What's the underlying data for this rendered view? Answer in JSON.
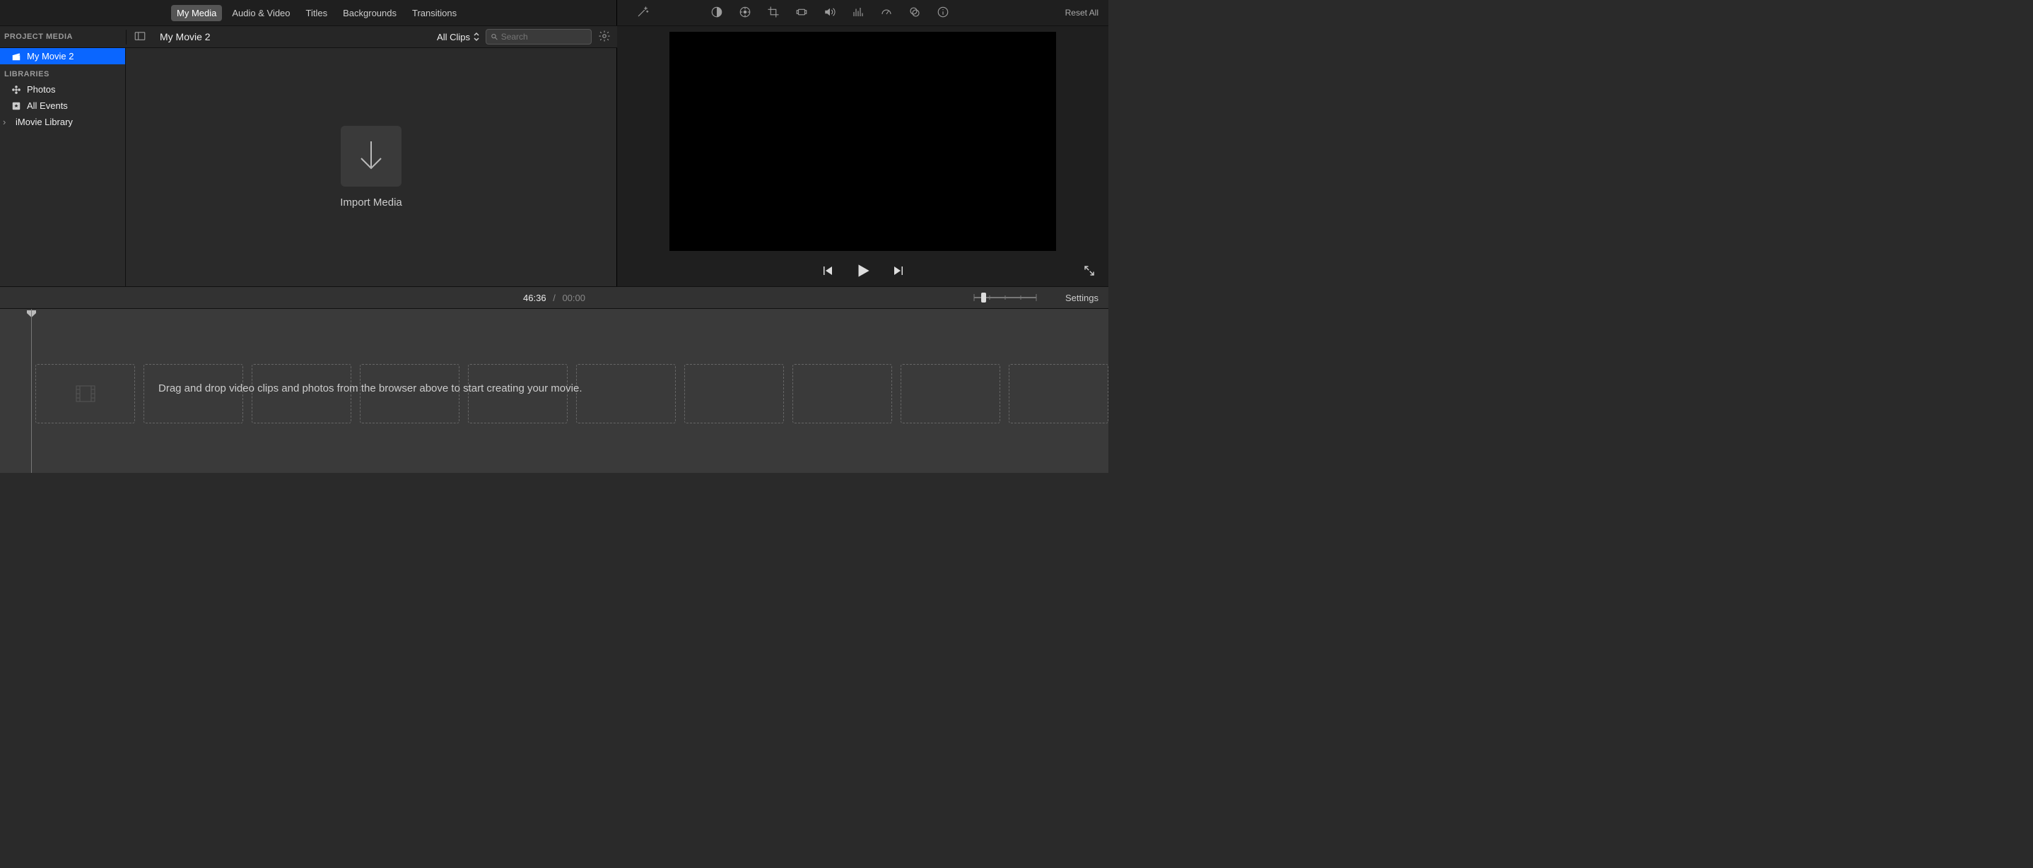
{
  "tabs": {
    "my_media": "My Media",
    "audio_video": "Audio & Video",
    "titles": "Titles",
    "backgrounds": "Backgrounds",
    "transitions": "Transitions"
  },
  "adjust_toolbar": {
    "reset_all": "Reset All"
  },
  "browser_header": {
    "project_media": "PROJECT MEDIA",
    "title": "My Movie 2",
    "filter": "All Clips",
    "search_placeholder": "Search"
  },
  "sidebar": {
    "project_item": "My Movie 2",
    "libraries_heading": "LIBRARIES",
    "photos": "Photos",
    "all_events": "All Events",
    "imovie_library": "iMovie Library"
  },
  "import": {
    "label": "Import Media"
  },
  "timeline": {
    "time_left": "46:36",
    "time_right": "00:00",
    "settings": "Settings",
    "hint": "Drag and drop video clips and photos from the browser above to start creating your movie."
  }
}
